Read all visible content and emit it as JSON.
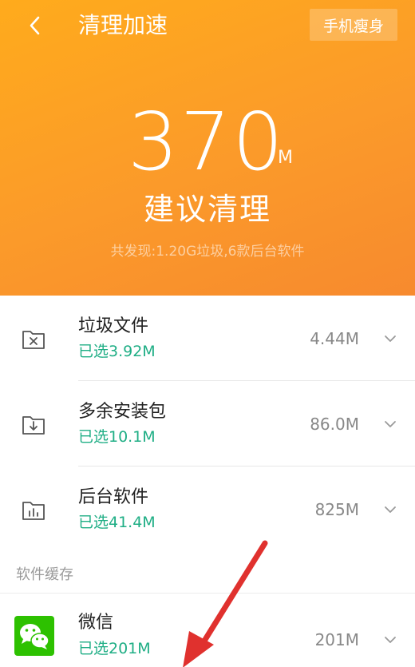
{
  "header": {
    "title": "清理加速",
    "slim_button": "手机瘦身",
    "back_icon": "chevron-left-icon"
  },
  "summary": {
    "amount": "370",
    "unit": "M",
    "suggestion": "建议清理",
    "found_text": "共发现:1.20G垃圾,6款后台软件"
  },
  "categories": [
    {
      "name": "垃圾文件",
      "selected": "已选3.92M",
      "size": "4.44M",
      "icon": "junk-folder-icon"
    },
    {
      "name": "多余安装包",
      "selected": "已选10.1M",
      "size": "86.0M",
      "icon": "package-download-icon"
    },
    {
      "name": "后台软件",
      "selected": "已选41.4M",
      "size": "825M",
      "icon": "background-app-chart-icon"
    }
  ],
  "section": {
    "label": "软件缓存"
  },
  "apps": [
    {
      "name": "微信",
      "selected": "已选201M",
      "size": "201M",
      "icon": "wechat-icon"
    }
  ],
  "colors": {
    "header_gradient_start": "#ffab1c",
    "header_gradient_end": "#f78a2e",
    "selected_text": "#1fae85",
    "annotation_arrow": "#e0312e",
    "wechat_green": "#2dc100"
  }
}
